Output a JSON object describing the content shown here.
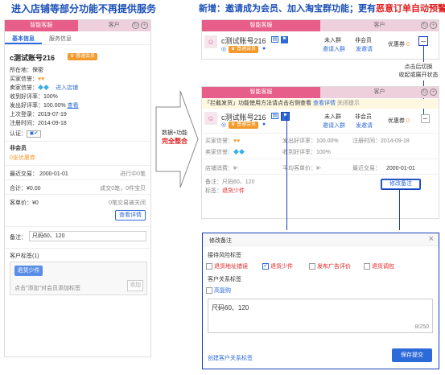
{
  "headers": {
    "left": "进入店铺等部分功能不再提供服务",
    "right_prefix": "新增：邀请成为会员、加入淘宝群功能；更有",
    "right_red": "恶意订单自动预警"
  },
  "colors": {
    "pink": "#e85e8a",
    "blue": "#2d6ad9",
    "orange": "#f39a2d",
    "red": "#e02020"
  },
  "left_panel": {
    "tabs": [
      "智能客服",
      "客户"
    ],
    "subtabs": [
      "基本信息",
      "服务信息"
    ],
    "account": "c测试账号216",
    "member_badge": "普通会员",
    "location_label": "所在地：",
    "location": "保密",
    "buyer_credit": "买家信誉：",
    "seller_credit": "卖家信誉：",
    "enter_shop": "进入店铺",
    "received_rate": "收到好评率：100%",
    "sent_rate": "发出好评率：100.00%",
    "view": "查看",
    "last_login": "上次登录：2019-07-19",
    "register": "注册时间：2014-09-18",
    "auth": "认证：",
    "nonmember": "非会员",
    "coupon": "0张优惠券",
    "recent": "最近交易： 2000-01-01",
    "in_progress": "进行中0笔",
    "total": "合计：¥0.00",
    "total_detail": "成交0笔，0件宝贝",
    "avg": "客单价：¥0",
    "closed": "0笔交易被关闭",
    "detail_btn": "查看详情",
    "note_label": "备注：",
    "note_value": "尺码60、120",
    "tags_label": "客户标签(1)",
    "tag": "退货少件",
    "tag_hint": "点击\"添加\"对会员添加标签",
    "add_btn": "添加"
  },
  "middle": {
    "label": "数据+功能",
    "label_red": "完全整合"
  },
  "card_top": {
    "tabs": [
      "智能客服",
      "客户"
    ],
    "account": "c测试账号216",
    "member_badge": "普通会员",
    "group_status": "未入群",
    "invite_group": "邀请入群",
    "member_status": "非会员",
    "send_invite": "发邀请",
    "coupon_label": "优惠券",
    "coupon_count": "0"
  },
  "callout": {
    "line1": "点击后切换",
    "line2": "收起或展开状态"
  },
  "card_bottom": {
    "tabs": [
      "智能客服",
      "客户"
    ],
    "notice": "「拦截发货」功能使用方法请点击右侧查看",
    "notice_link": "查看详情",
    "notice_close": "关闭提示",
    "account": "c测试账号216",
    "member_badge": "普通会员",
    "group_status": "未入群",
    "invite_group": "邀请入群",
    "member_status": "非会员",
    "send_invite": "发邀请",
    "coupon_label": "优惠券",
    "coupon_count": "0",
    "buyer_credit": "买家信誉：",
    "sent_rate": "发出好评率：100.00%",
    "register": "注册时间：2014-09-18",
    "seller_credit": "卖家信誉：",
    "received_rate": "收到好评率：100%",
    "shop_spend": "店铺消费：¥-",
    "avg_price": "平均客单价：¥-",
    "recent": "最近交易：",
    "recent_date": "2000-01-01",
    "note": "备注：尺码60、120",
    "tag_label": "标签：",
    "tag": "退货少件",
    "edit_btn": "修改备注"
  },
  "dialog": {
    "title": "修改备注",
    "risk_title": "接待风险标签",
    "risk_options": [
      {
        "label": "退货地址错误",
        "checked": false
      },
      {
        "label": "退货少件",
        "checked": true
      },
      {
        "label": "发布广告评价",
        "checked": false
      },
      {
        "label": "退货调包",
        "checked": false
      }
    ],
    "relation_title": "客户关系标签",
    "relation_option": "高复购",
    "textarea": "尺码60、120",
    "counter": "8/250",
    "create_link": "创建客户关系标签",
    "save_btn": "保存提交"
  }
}
